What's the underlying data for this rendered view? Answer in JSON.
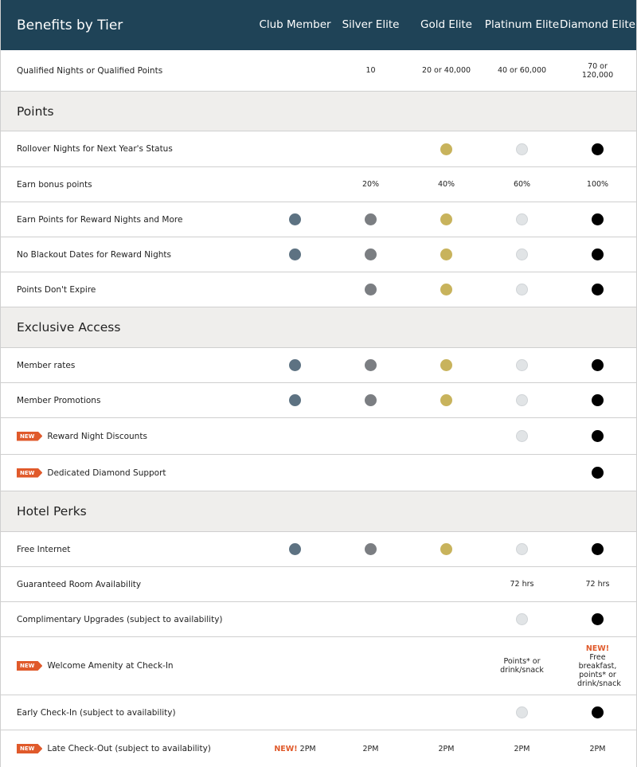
{
  "header": {
    "title": "Benefits by Tier",
    "tiers": [
      "Club Member",
      "Silver Elite",
      "Gold Elite",
      "Platinum Elite",
      "Diamond Elite"
    ]
  },
  "colors": {
    "header_bg": "#1f4357",
    "club": "#5d7282",
    "silver": "#7b7e82",
    "gold": "#c8b35c",
    "platinum": "#e1e4e6",
    "diamond": "#000000",
    "new": "#e05a2b"
  },
  "new_label": "NEW",
  "new_inline": "NEW!",
  "qualified": {
    "label": "Qualified Nights or Qualified Points",
    "values": [
      "",
      "10",
      "20 or 40,000",
      "40 or 60,000",
      "70 or 120,000"
    ]
  },
  "sections": {
    "points": "Points",
    "exclusive": "Exclusive Access",
    "perks": "Hotel Perks"
  },
  "rows": {
    "rollover": "Rollover Nights for Next Year's Status",
    "bonus": {
      "label": "Earn bonus points",
      "values": [
        "",
        "20%",
        "40%",
        "60%",
        "100%"
      ]
    },
    "earn": "Earn Points for Reward Nights and More",
    "blackout": "No Blackout Dates for Reward Nights",
    "expire": "Points Don't Expire",
    "rates": "Member rates",
    "promos": "Member Promotions",
    "discounts": "Reward Night Discounts",
    "support": "Dedicated Diamond Support",
    "internet": "Free Internet",
    "guaranteed": {
      "label": "Guaranteed Room Availability",
      "platinum": "72 hrs",
      "diamond": "72 hrs"
    },
    "upgrades": "Complimentary Upgrades (subject to availability)",
    "welcome": {
      "label": "Welcome Amenity at Check-In",
      "platinum": "Points* or drink/snack",
      "diamond": "Free breakfast, points* or drink/snack"
    },
    "early": "Early Check-In (subject to availability)",
    "late": {
      "label": "Late Check-Out (subject to availability)",
      "values": [
        "2PM",
        "2PM",
        "2PM",
        "2PM",
        "2PM"
      ]
    }
  }
}
